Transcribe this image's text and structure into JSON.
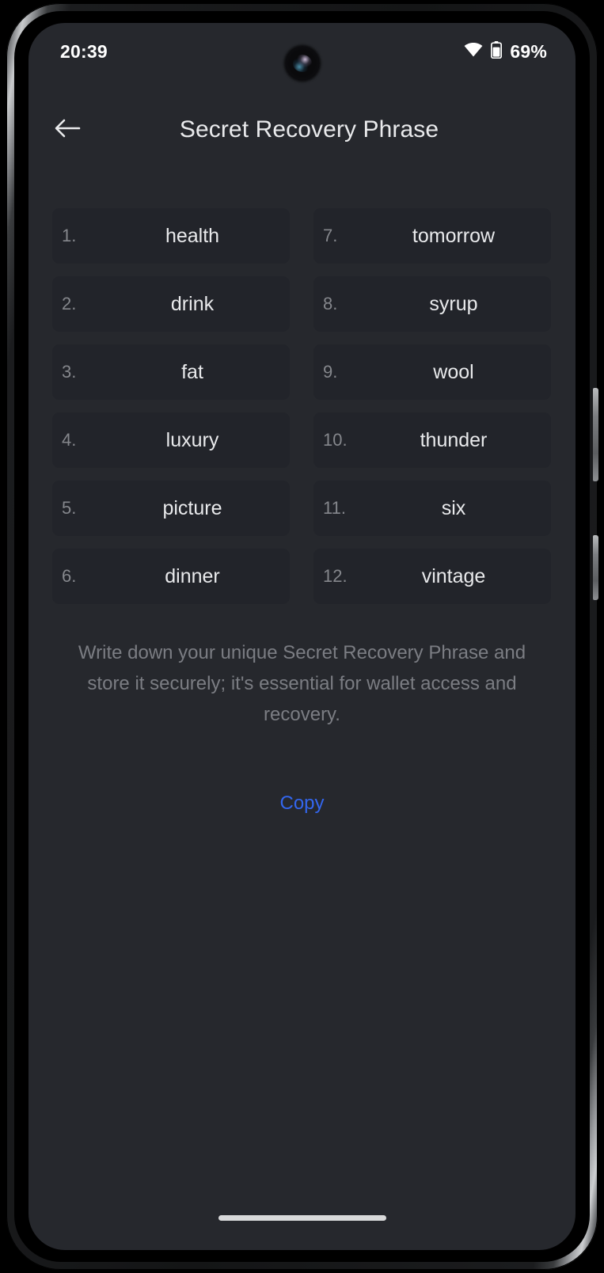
{
  "status_bar": {
    "time": "20:39",
    "battery_text": "69%",
    "wifi_icon": "wifi-icon",
    "battery_icon": "battery-icon",
    "battery_level_percent": 69
  },
  "header": {
    "back_icon": "back-arrow-icon",
    "title": "Secret Recovery Phrase"
  },
  "recovery_phrase": {
    "words": [
      {
        "index": "1.",
        "word": "health"
      },
      {
        "index": "2.",
        "word": "drink"
      },
      {
        "index": "3.",
        "word": "fat"
      },
      {
        "index": "4.",
        "word": "luxury"
      },
      {
        "index": "5.",
        "word": "picture"
      },
      {
        "index": "6.",
        "word": "dinner"
      },
      {
        "index": "7.",
        "word": "tomorrow"
      },
      {
        "index": "8.",
        "word": "syrup"
      },
      {
        "index": "9.",
        "word": "wool"
      },
      {
        "index": "10.",
        "word": "thunder"
      },
      {
        "index": "11.",
        "word": "six"
      },
      {
        "index": "12.",
        "word": "vintage"
      }
    ]
  },
  "description": "Write down your unique Secret Recovery Phrase and store it securely; it's essential for wallet access and recovery.",
  "actions": {
    "copy_label": "Copy"
  },
  "colors": {
    "screen_background": "#26282d",
    "cell_background": "#22242a",
    "primary_text": "#e9eaec",
    "muted_text": "#7b7d83",
    "index_text": "#85878c",
    "accent_link": "#3366ee",
    "home_indicator": "#d8d9da"
  }
}
